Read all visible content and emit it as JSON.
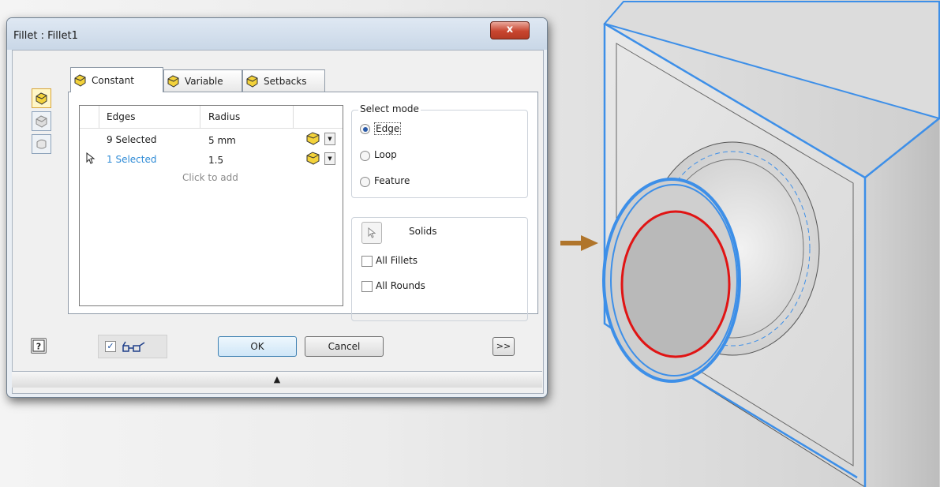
{
  "dialog": {
    "title": "Fillet : Fillet1",
    "close_glyph": "x",
    "side_buttons": [
      {
        "icon": "edge-fillet-icon",
        "active": true
      },
      {
        "icon": "face-fillet-icon",
        "active": false
      },
      {
        "icon": "full-round-fillet-icon",
        "active": false
      }
    ],
    "tabs": [
      {
        "label": "Constant",
        "icon": "constant-cube-icon",
        "active": true
      },
      {
        "label": "Variable",
        "icon": "variable-cube-icon",
        "active": false
      },
      {
        "label": "Setbacks",
        "icon": "setbacks-cube-icon",
        "active": false
      }
    ],
    "grid": {
      "headers": [
        "Edges",
        "Radius"
      ],
      "rows": [
        {
          "edges": "9 Selected",
          "radius": "5 mm",
          "highlight": false
        },
        {
          "edges": "1 Selected",
          "radius": "1.5",
          "highlight": true
        }
      ],
      "add_row": "Click to add"
    },
    "select_mode": {
      "legend": "Select mode",
      "options": [
        {
          "label": "Edge",
          "selected": true
        },
        {
          "label": "Loop",
          "selected": false
        },
        {
          "label": "Feature",
          "selected": false
        }
      ]
    },
    "solids": {
      "label": "Solids",
      "checkboxes": [
        {
          "label": "All Fillets",
          "checked": false
        },
        {
          "label": "All Rounds",
          "checked": false
        }
      ]
    },
    "footer": {
      "preview_checked": true,
      "preview_icon": "glasses-icon",
      "ok": "OK",
      "cancel": "Cancel",
      "more": ">>",
      "help_icon": "help-icon"
    },
    "colors": {
      "accent_blue": "#2f8bd6",
      "selection_blue": "#3d8fe8",
      "selection_red": "#e01414",
      "arrow": "#b0752b"
    }
  }
}
